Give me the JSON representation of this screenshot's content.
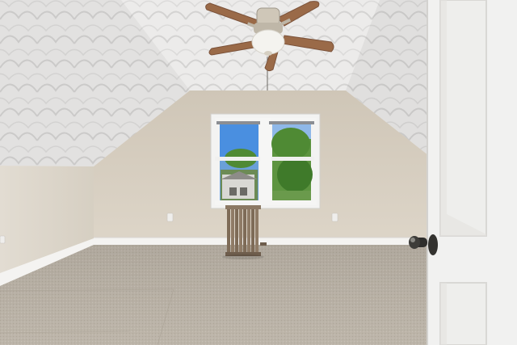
{
  "scene": {
    "subject": "attic-bedroom",
    "colors": {
      "ceiling": "#ecebea",
      "wall": "#d9d0c2",
      "side_wall": "#ddd6ca",
      "baseboard": "#f4f3f1",
      "carpet": "#b9b1a5",
      "door": "#f1f1f0",
      "fan_blade": "#9a6a48",
      "sky": "#4a8fe0",
      "foliage": "#4f8a34"
    },
    "icons": [
      "ceiling-fan-icon",
      "radiator-icon",
      "door-knob-icon",
      "outlet-icon"
    ]
  }
}
